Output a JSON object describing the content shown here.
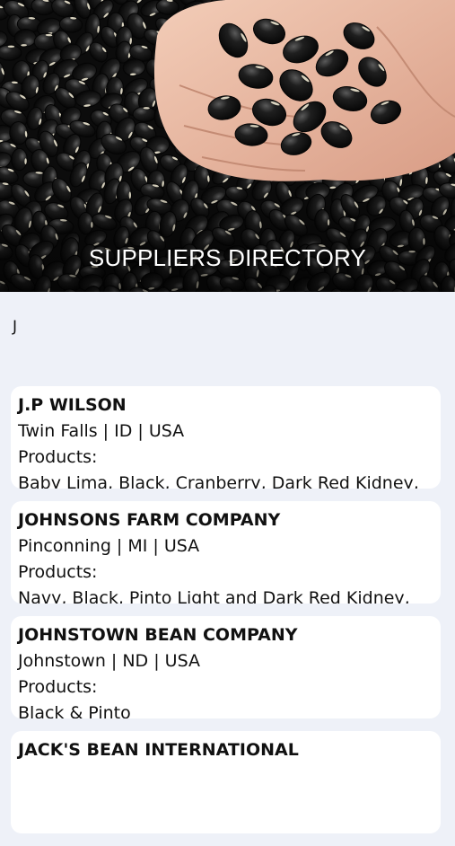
{
  "header": {
    "title": "SUPPLIERS DIRECTORY"
  },
  "section": {
    "letter": "J"
  },
  "suppliers": [
    {
      "name": "J.P WILSON",
      "location": "Twin Falls | ID | USA",
      "products_label": "Products:",
      "products": "Baby Lima, Black, Cranberry, Dark Red Kidney,"
    },
    {
      "name": "JOHNSONS FARM COMPANY",
      "location": "Pinconning | MI | USA",
      "products_label": "Products:",
      "products": "Navy, Black, Pinto Light and Dark Red Kidney,"
    },
    {
      "name": "JOHNSTOWN BEAN COMPANY",
      "location": "Johnstown | ND | USA",
      "products_label": "Products:",
      "products": "Black & Pinto"
    },
    {
      "name": "JACK'S BEAN INTERNATIONAL",
      "location": "",
      "products_label": "",
      "products": ""
    }
  ]
}
